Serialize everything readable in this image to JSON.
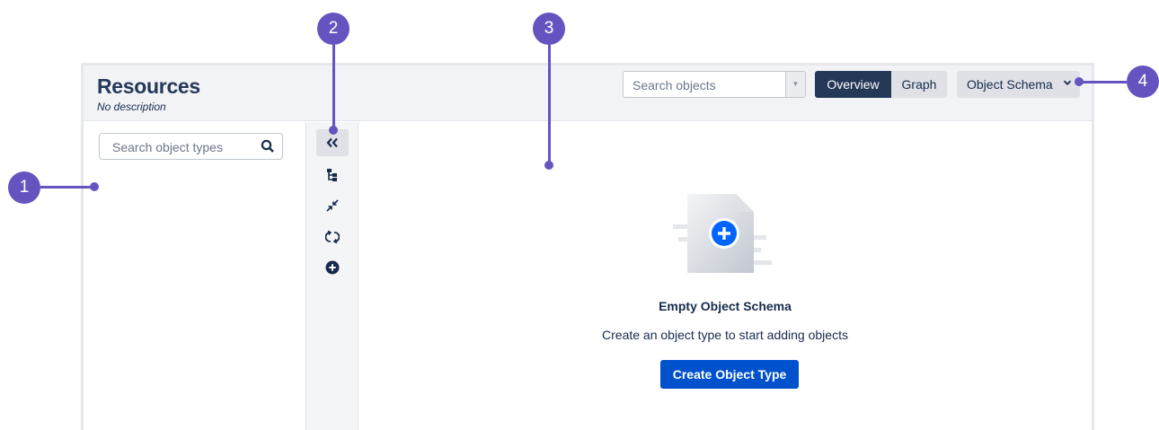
{
  "header": {
    "title": "Resources",
    "description": "No description",
    "search_placeholder": "Search objects",
    "overview_label": "Overview",
    "graph_label": "Graph",
    "schema_label": "Object Schema"
  },
  "sidebar": {
    "search_placeholder": "Search object types"
  },
  "toolbar": {
    "tools": [
      "collapse-icon",
      "tree-icon",
      "compress-icon",
      "refresh-icon",
      "add-icon"
    ]
  },
  "main": {
    "empty_title": "Empty Object Schema",
    "empty_subtitle": "Create an object type to start adding objects",
    "create_label": "Create Object Type"
  },
  "callouts": [
    "1",
    "2",
    "3",
    "4"
  ],
  "colors": {
    "accent": "#6554c0",
    "primary_button": "#0052cc",
    "overview_active": "#253858"
  }
}
